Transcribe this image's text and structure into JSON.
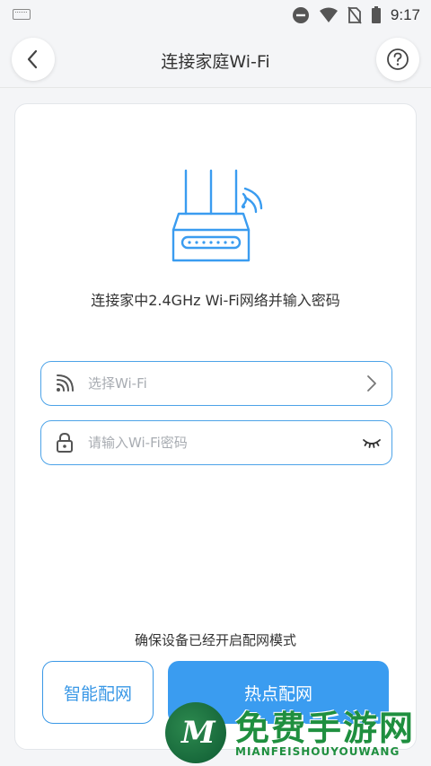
{
  "status_bar": {
    "time": "9:17",
    "icons": [
      "keyboard-icon",
      "do-not-disturb-icon",
      "wifi-signal-icon",
      "no-sim-icon",
      "battery-icon"
    ]
  },
  "header": {
    "title": "连接家庭Wi-Fi",
    "back_icon": "chevron-left-icon",
    "help_icon": "question-circle-icon"
  },
  "main": {
    "illustration": "router-icon",
    "instruction": "连接家中2.4GHz Wi-Fi网络并输入密码",
    "ssid_field": {
      "placeholder": "选择Wi-Fi",
      "value": "",
      "icon": "wifi-icon",
      "trailing_icon": "chevron-right-icon"
    },
    "password_field": {
      "placeholder": "请输入Wi-Fi密码",
      "value": "",
      "icon": "lock-icon",
      "trailing_icon": "eye-closed-icon"
    },
    "hint": "确保设备已经开启配网模式",
    "smart_button": "智能配网",
    "hotspot_button": "热点配网"
  },
  "watermark": {
    "title": "免费手游网",
    "subtitle": "MIANFEISHOUYOUWANG",
    "logo_letter": "M"
  },
  "colors": {
    "accent": "#3a9cf0",
    "accent_border": "#4da3e8",
    "watermark_green": "#1f8f3f"
  }
}
